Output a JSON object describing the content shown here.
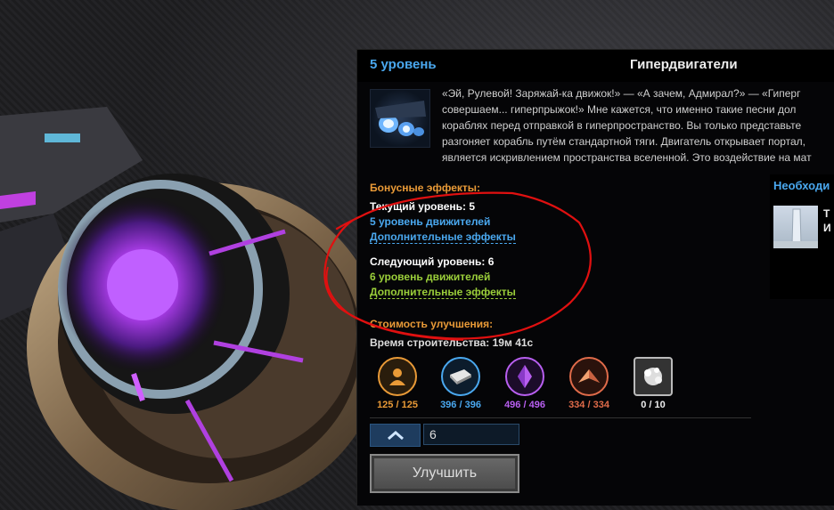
{
  "header": {
    "level": "5 уровень",
    "title": "Гипердвигатели"
  },
  "description": "«Эй, Рулевой! Заряжай-ка движок!» — «А зачем, Адмирал?» — «Гиперг\nсовершаем... гиперпрыжок!» Мне кажется, что именно такие песни дол\nкораблях перед отправкой в гиперпространство. Вы только представьте\nразгоняет корабль путём стандартной тяги. Двигатель открывает портал,\nявляется искривлением пространства вселенной. Это воздействие на мат",
  "requirements": {
    "title": "Необходи",
    "item": "Т\nИ"
  },
  "bonus": {
    "title": "Бонусные эффекты:",
    "current_label": "Текущий уровень: 5",
    "current_link": "5 уровень движителей",
    "current_extra": "Дополнительные эффекты",
    "next_label": "Следующий уровень: 6",
    "next_link": "6 уровень движителей",
    "next_extra": "Дополнительные эффекты"
  },
  "cost": {
    "title": "Стоимость улучшения:",
    "build_time": "Время строительства: 19м 41с",
    "resources": [
      {
        "icon": "pilot-icon",
        "value": "125 / 125",
        "color": "#e99a37"
      },
      {
        "icon": "metal-plate-icon",
        "value": "396 / 396",
        "color": "#4aa8ef"
      },
      {
        "icon": "crystal-icon",
        "value": "496 / 496",
        "color": "#b85ff0"
      },
      {
        "icon": "arrowhead-icon",
        "value": "334 / 334",
        "color": "#e06b4a"
      },
      {
        "icon": "dust-icon",
        "value": "0 / 10",
        "color": "#eeeeee"
      }
    ]
  },
  "controls": {
    "quantity": "6",
    "upgrade_label": "Улучшить"
  },
  "colors": {
    "accent_blue": "#4aa8ef",
    "orange": "#e99a37",
    "green": "#9bcf3a",
    "annotation_red": "#e01010"
  }
}
